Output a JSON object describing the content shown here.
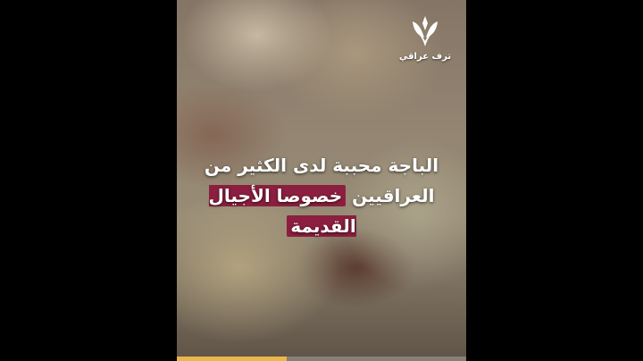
{
  "logo": {
    "icon": "stylized-sheaf-logo-icon",
    "text": "ترف عراقي"
  },
  "caption": {
    "line1": "الباجة محببة لدى الكثير من",
    "line2_plain": "العراقيين",
    "line2_highlight": "خصوصا الأجيال القديمة"
  },
  "colors": {
    "highlight": "#8c1f3f",
    "progress": "#e8b84a"
  },
  "progress": {
    "fraction": 0.38
  }
}
